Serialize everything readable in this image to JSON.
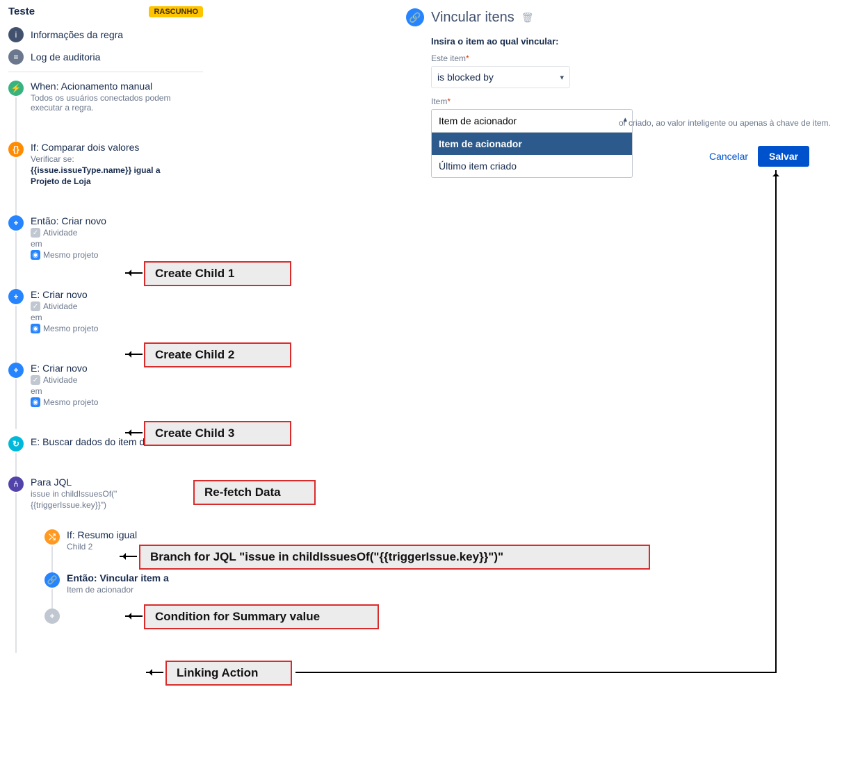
{
  "header": {
    "rule_name": "Teste",
    "draft_badge": "RASCUNHO"
  },
  "nav": {
    "info": "Informações da regra",
    "audit": "Log de auditoria"
  },
  "steps": {
    "when": {
      "title": "When: Acionamento manual",
      "desc": "Todos os usuários conectados podem executar a regra."
    },
    "if_compare": {
      "title": "If: Comparar dois valores",
      "l1": "Verificar se:",
      "l2": "{{issue.issueType.name}} igual a",
      "l3": "Projeto de Loja"
    },
    "create1": {
      "title": "Então: Criar novo",
      "type": "Atividade",
      "in": "em",
      "proj": "Mesmo projeto"
    },
    "create2": {
      "title": "E: Criar novo",
      "type": "Atividade",
      "in": "em",
      "proj": "Mesmo projeto"
    },
    "create3": {
      "title": "E: Criar novo",
      "type": "Atividade",
      "in": "em",
      "proj": "Mesmo projeto"
    },
    "refetch": {
      "title": "E: Buscar dados do item de novo"
    },
    "branch": {
      "title": "Para JQL",
      "l1": "issue in childIssuesOf(\"",
      "l2": "{{triggerIssue.key}}\")"
    },
    "cond": {
      "title": "If: Resumo igual",
      "l1": "Child 2"
    },
    "link": {
      "title": "Então: Vincular item a",
      "l1": "Item de acionador"
    }
  },
  "config": {
    "title": "Vincular itens",
    "instruction": "Insira o item ao qual vincular:",
    "field1_label": "Este item",
    "field1_value": "is blocked by",
    "field2_label": "Item",
    "field2_input": "Item de acionador",
    "dd_opt1": "Item de acionador",
    "dd_opt2": "Último item criado",
    "hint": "or criado, ao valor inteligente ou apenas à chave de item.",
    "cancel": "Cancelar",
    "save": "Salvar"
  },
  "ann": {
    "c1": "Create Child 1",
    "c2": "Create Child 2",
    "c3": "Create Child 3",
    "rf": "Re-fetch Data",
    "br": "Branch for JQL \"issue in childIssuesOf(\"{{triggerIssue.key}}\")\"",
    "cd": "Condition for Summary value",
    "lk": "Linking Action"
  }
}
